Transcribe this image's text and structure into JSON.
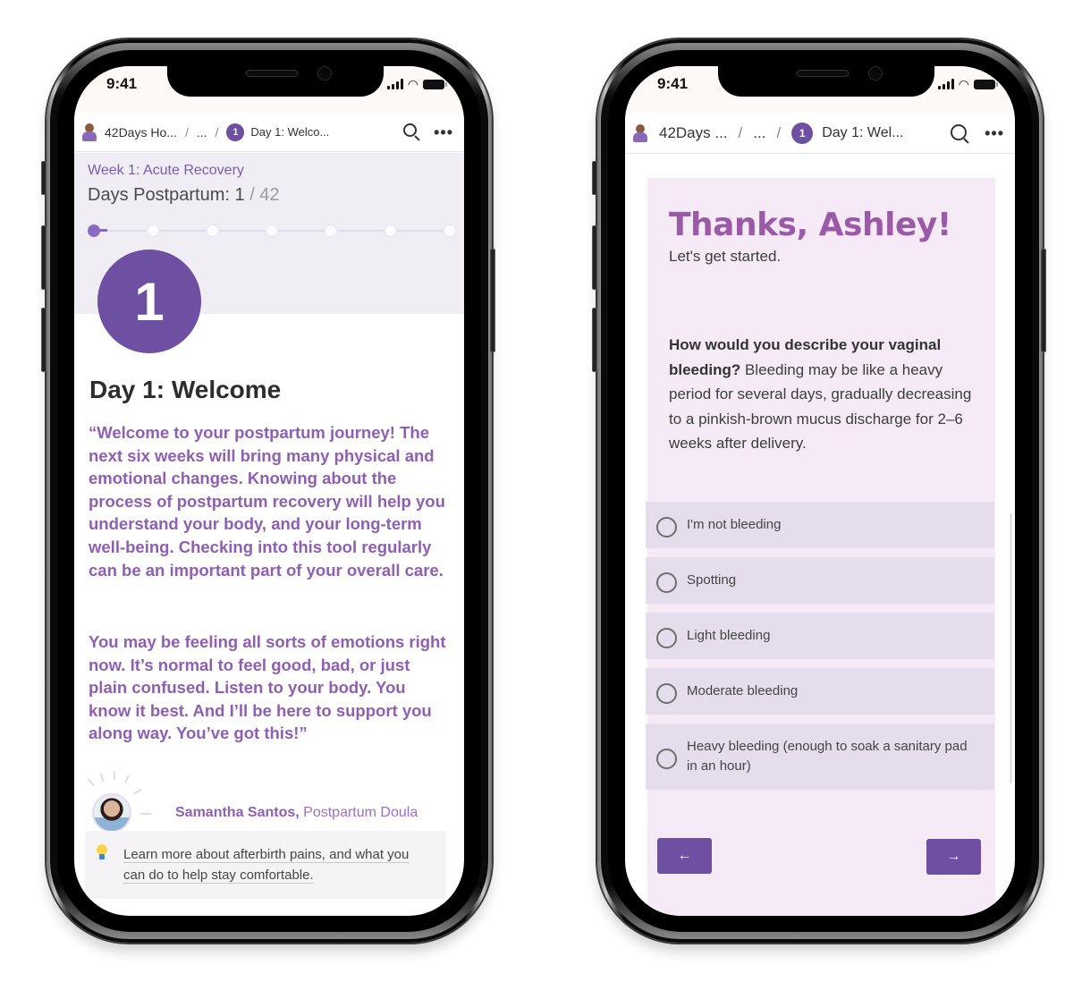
{
  "status_bar": {
    "time": "9:41"
  },
  "left_screen": {
    "breadcrumb": {
      "app": "42Days Ho...",
      "ellipsis": "...",
      "separator": "/",
      "page_number": "1",
      "page": "Day 1: Welco..."
    },
    "week_label": "Week 1: Acute Recovery",
    "days_prefix": "Days Postpartum: ",
    "days_current": "1",
    "days_total": " / 42",
    "progress": {
      "current_day": 1,
      "total_days": 42,
      "milestones": 7
    },
    "day_badge": "1",
    "title": "Day 1: Welcome",
    "quote_paragraph_1": "“Welcome to your postpartum journey! The next six weeks will bring many physical and emotional changes. Knowing about the process of postpartum recovery will help you understand your body, and your long-term well-being. Checking into this tool regularly can be an important part of your overall care.",
    "quote_paragraph_2": "You may be feeling all sorts of emotions right now. It’s normal to feel good, bad, or just plain confused. Listen to your body. You know it best. And I’ll be here to support you along way. You’ve got this!”",
    "author_name": "Samantha Santos,",
    "author_role": " Postpartum Doula",
    "tip_link": "Learn more about afterbirth pains, and what you can do to help stay comfortable."
  },
  "right_screen": {
    "breadcrumb": {
      "app": "42Days ...",
      "ellipsis": "...",
      "separator": "/",
      "page_number": "1",
      "page": "Day 1: Wel..."
    },
    "heading": "Thanks, Ashley!",
    "subheading": "Let's get started.",
    "question_bold": "How would you describe your vaginal bleeding?",
    "question_body": " Bleeding may be like a heavy period for several days, gradually decreasing to a pinkish-brown mucus discharge for 2–6 weeks after delivery.",
    "options": [
      {
        "label": "I'm not bleeding",
        "selected": false
      },
      {
        "label": "Spotting",
        "selected": false
      },
      {
        "label": "Light bleeding",
        "selected": false
      },
      {
        "label": "Moderate bleeding",
        "selected": false
      },
      {
        "label": "Heavy bleeding (enough to soak a sanitary pad in an hour)",
        "selected": false
      }
    ],
    "back_button": "←",
    "next_button": "→"
  },
  "colors": {
    "brand_purple": "#6e50a3",
    "quote_purple": "#8e5fb5",
    "heading_purple": "#9b5aa8",
    "hero_band": "#f1edf5",
    "form_background": "#f5eaf5",
    "option_background": "#e5dcec"
  }
}
